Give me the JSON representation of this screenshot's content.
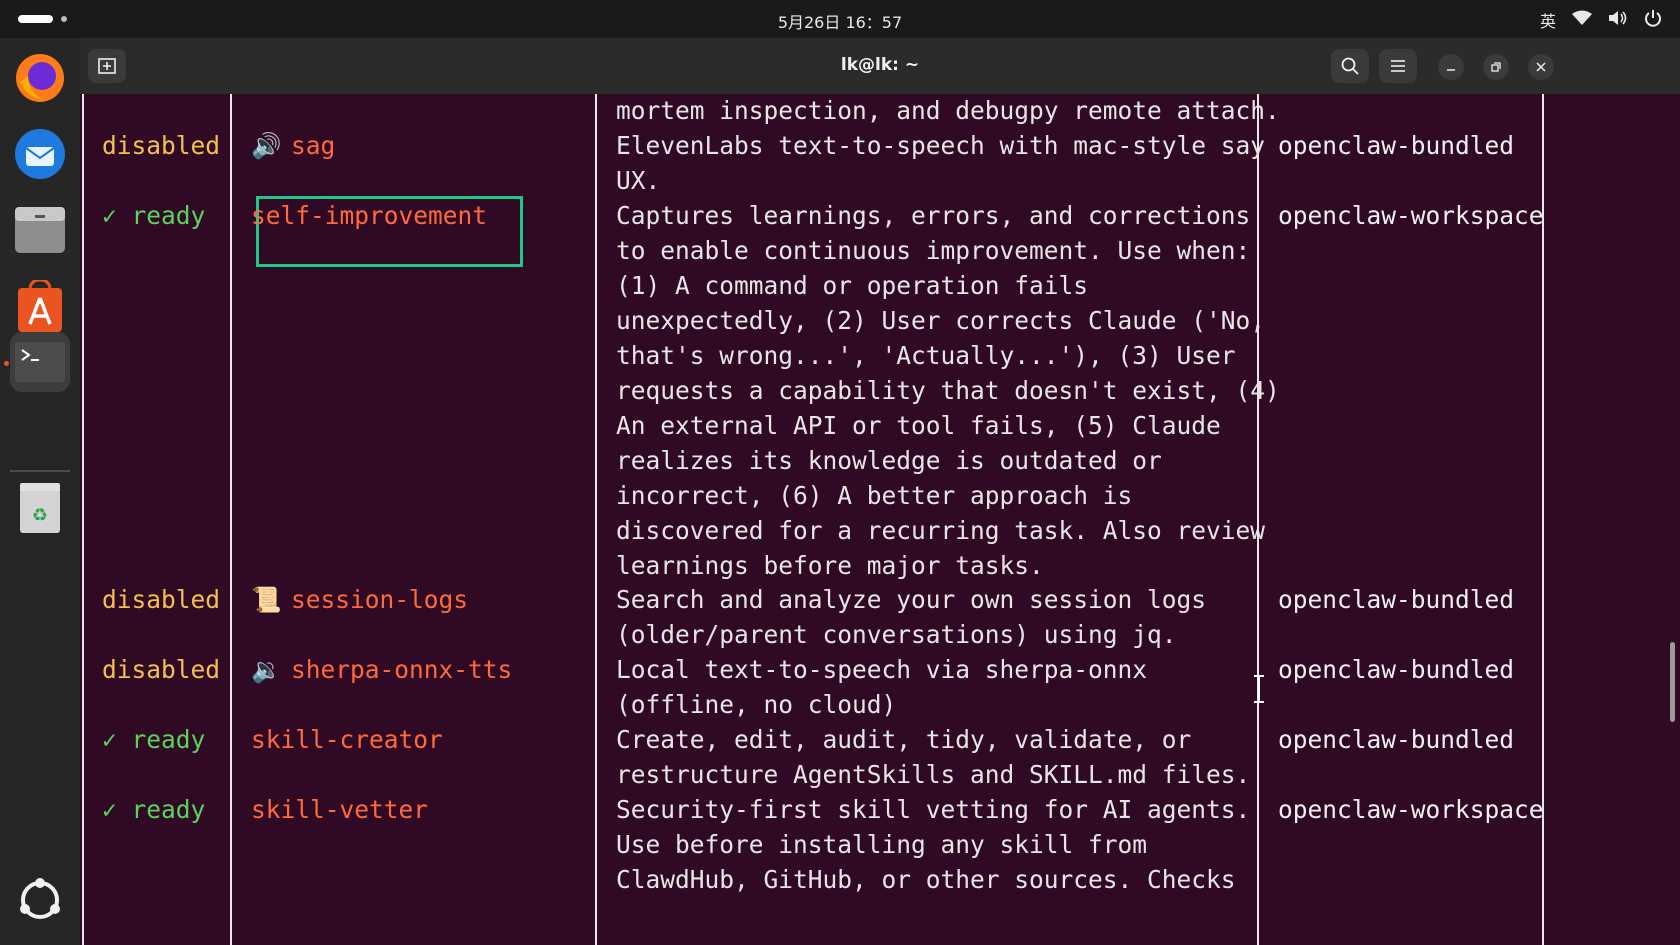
{
  "system_bar": {
    "clock": "5月26日  16：57",
    "input_method": "英"
  },
  "dock": {
    "items": [
      {
        "name": "firefox-icon"
      },
      {
        "name": "thunderbird-icon"
      },
      {
        "name": "files-icon"
      },
      {
        "name": "app-center-icon"
      },
      {
        "name": "terminal-icon"
      },
      {
        "name": "trash-icon"
      },
      {
        "name": "show-apps-icon"
      }
    ]
  },
  "window": {
    "title": "lk@lk: ~"
  },
  "terminal": {
    "rows": [
      {
        "status": "",
        "emoji": "",
        "skill": "",
        "desc": [
          "mortem inspection, and debugpy remote attach."
        ],
        "source": ""
      },
      {
        "status": "disabled",
        "emoji": "🔊",
        "skill": "sag",
        "desc": [
          "ElevenLabs text-to-speech with mac-style say",
          "UX."
        ],
        "source": "openclaw-bundled"
      },
      {
        "status": "✓ ready",
        "emoji": "",
        "skill": "self-improvement",
        "desc": [
          "Captures learnings, errors, and corrections",
          "to enable continuous improvement. Use when:",
          "(1) A command or operation fails",
          "unexpectedly, (2) User corrects Claude ('No,",
          "that's wrong...', 'Actually...'), (3) User",
          "requests a capability that doesn't exist, (4)",
          "An external API or tool fails, (5) Claude",
          "realizes its knowledge is outdated or",
          "incorrect, (6) A better approach is",
          "discovered for a recurring task. Also review",
          "learnings before major tasks."
        ],
        "source": "openclaw-workspace"
      },
      {
        "status": "disabled",
        "emoji": "📜",
        "skill": "session-logs",
        "desc": [
          "Search and analyze your own session logs",
          "(older/parent conversations) using jq."
        ],
        "source": "openclaw-bundled"
      },
      {
        "status": "disabled",
        "emoji": "🔉",
        "skill": "sherpa-onnx-tts",
        "desc": [
          "Local text-to-speech via sherpa-onnx",
          "(offline, no cloud)"
        ],
        "source": "openclaw-bundled"
      },
      {
        "status": "✓ ready",
        "emoji": "",
        "skill": "skill-creator",
        "desc": [
          "Create, edit, audit, tidy, validate, or",
          "restructure AgentSkills and SKILL.md files."
        ],
        "source": "openclaw-bundled"
      },
      {
        "status": "✓ ready",
        "emoji": "",
        "skill": "skill-vetter",
        "desc": [
          "Security-first skill vetting for AI agents.",
          "Use before installing any skill from",
          "ClawdHub, GitHub, or other sources. Checks"
        ],
        "source": "openclaw-workspace"
      }
    ]
  },
  "colors": {
    "terminal_bg": "#300a24",
    "status_disabled": "#f2c14e",
    "status_ready": "#5ad35a",
    "skill_name": "#ff6a3d",
    "highlight_box": "#1ec98a"
  }
}
